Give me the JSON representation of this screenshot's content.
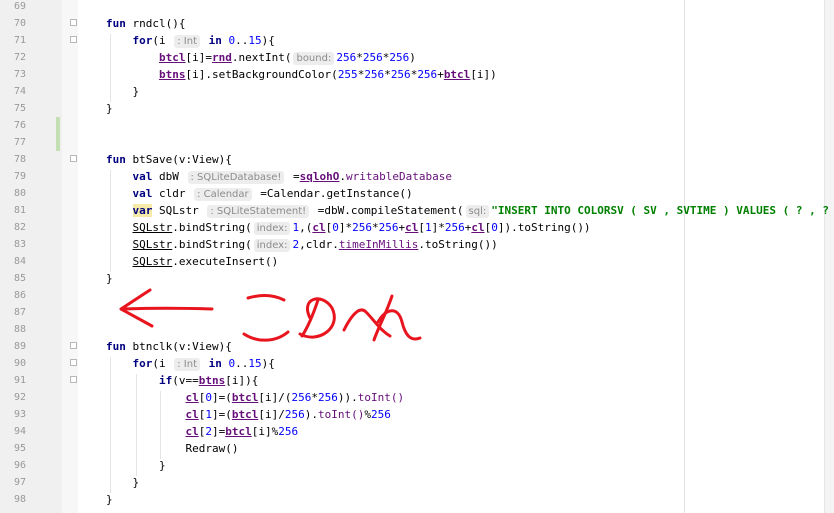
{
  "editor": {
    "line_numbers": [
      "69",
      "70",
      "71",
      "72",
      "73",
      "74",
      "75",
      "76",
      "77",
      "78",
      "79",
      "80",
      "81",
      "82",
      "83",
      "84",
      "85",
      "86",
      "87",
      "88",
      "89",
      "90",
      "91",
      "92",
      "93",
      "94",
      "95",
      "96",
      "97",
      "98"
    ],
    "lines": [
      [],
      [
        {
          "t": "fun ",
          "c": "kw"
        },
        {
          "t": "rndcl(){"
        }
      ],
      [
        {
          "t": "    "
        },
        {
          "t": "for",
          "c": "kw"
        },
        {
          "t": "(i "
        },
        {
          "t": ": Int",
          "c": "hint"
        },
        {
          "t": " in ",
          "c": "kw"
        },
        {
          "t": "0",
          "c": "num"
        },
        {
          "t": ".."
        },
        {
          "t": "15",
          "c": "num"
        },
        {
          "t": "){"
        }
      ],
      [
        {
          "t": "        "
        },
        {
          "t": "btcl",
          "c": "fld"
        },
        {
          "t": "[i]="
        },
        {
          "t": "rnd",
          "c": "fld"
        },
        {
          "t": ".nextInt("
        },
        {
          "t": "bound:",
          "c": "hint"
        },
        {
          "t": "256",
          "c": "num"
        },
        {
          "t": "*"
        },
        {
          "t": "256",
          "c": "num"
        },
        {
          "t": "*"
        },
        {
          "t": "256",
          "c": "num"
        },
        {
          "t": ")"
        }
      ],
      [
        {
          "t": "        "
        },
        {
          "t": "btns",
          "c": "fld"
        },
        {
          "t": "[i].setBackgroundColor("
        },
        {
          "t": "255",
          "c": "num"
        },
        {
          "t": "*"
        },
        {
          "t": "256",
          "c": "num"
        },
        {
          "t": "*"
        },
        {
          "t": "256",
          "c": "num"
        },
        {
          "t": "*"
        },
        {
          "t": "256",
          "c": "num"
        },
        {
          "t": "+"
        },
        {
          "t": "btcl",
          "c": "fld"
        },
        {
          "t": "[i])"
        }
      ],
      [
        {
          "t": "    }"
        }
      ],
      [
        {
          "t": "}"
        }
      ],
      [],
      [],
      [
        {
          "t": "fun ",
          "c": "kw"
        },
        {
          "t": "btSave(v:View){"
        }
      ],
      [
        {
          "t": "    "
        },
        {
          "t": "val ",
          "c": "kw"
        },
        {
          "t": "dbW "
        },
        {
          "t": ": SQLiteDatabase!",
          "c": "hint"
        },
        {
          "t": " ="
        },
        {
          "t": "sqlohO",
          "c": "fld"
        },
        {
          "t": "."
        },
        {
          "t": "writableDatabase",
          "c": "prop"
        }
      ],
      [
        {
          "t": "    "
        },
        {
          "t": "val ",
          "c": "kw"
        },
        {
          "t": "cldr "
        },
        {
          "t": ": Calendar",
          "c": "hint"
        },
        {
          "t": " =Calendar.getInstance()"
        }
      ],
      [
        {
          "t": "    "
        },
        {
          "t": "var",
          "c": "kw varhl"
        },
        {
          "t": " SQLstr "
        },
        {
          "t": ": SQLiteStatement!",
          "c": "hint"
        },
        {
          "t": " =dbW.compileStatement("
        },
        {
          "t": "sql:",
          "c": "hint"
        },
        {
          "t": "\"INSERT INTO COLORSV ( SV , SVTIME ) VALUES ( ? , ? )\"",
          "c": "str"
        },
        {
          "t": ")"
        }
      ],
      [
        {
          "t": "    "
        },
        {
          "t": "SQLstr",
          "c": "ul"
        },
        {
          "t": ".bindString("
        },
        {
          "t": "index:",
          "c": "hint"
        },
        {
          "t": "1",
          "c": "num"
        },
        {
          "t": ",("
        },
        {
          "t": "cl",
          "c": "fld"
        },
        {
          "t": "["
        },
        {
          "t": "0",
          "c": "num"
        },
        {
          "t": "]*"
        },
        {
          "t": "256",
          "c": "num"
        },
        {
          "t": "*"
        },
        {
          "t": "256",
          "c": "num"
        },
        {
          "t": "+"
        },
        {
          "t": "cl",
          "c": "fld"
        },
        {
          "t": "["
        },
        {
          "t": "1",
          "c": "num"
        },
        {
          "t": "]*"
        },
        {
          "t": "256",
          "c": "num"
        },
        {
          "t": "+"
        },
        {
          "t": "cl",
          "c": "fld"
        },
        {
          "t": "["
        },
        {
          "t": "0",
          "c": "num"
        },
        {
          "t": "]).toString())"
        }
      ],
      [
        {
          "t": "    "
        },
        {
          "t": "SQLstr",
          "c": "ul"
        },
        {
          "t": ".bindString("
        },
        {
          "t": "index:",
          "c": "hint"
        },
        {
          "t": "2",
          "c": "num"
        },
        {
          "t": ",cldr."
        },
        {
          "t": "timeInMillis",
          "c": "prop ul"
        },
        {
          "t": ".toString())"
        }
      ],
      [
        {
          "t": "    "
        },
        {
          "t": "SQLstr",
          "c": "ul"
        },
        {
          "t": ".executeInsert()"
        }
      ],
      [
        {
          "t": "}"
        }
      ],
      [],
      [],
      [],
      [
        {
          "t": "fun ",
          "c": "kw"
        },
        {
          "t": "btnclk(v:View){"
        }
      ],
      [
        {
          "t": "    "
        },
        {
          "t": "for",
          "c": "kw"
        },
        {
          "t": "(i "
        },
        {
          "t": ": Int",
          "c": "hint"
        },
        {
          "t": " in ",
          "c": "kw"
        },
        {
          "t": "0",
          "c": "num"
        },
        {
          "t": ".."
        },
        {
          "t": "15",
          "c": "num"
        },
        {
          "t": "){"
        }
      ],
      [
        {
          "t": "        "
        },
        {
          "t": "if",
          "c": "kw"
        },
        {
          "t": "(v=="
        },
        {
          "t": "btns",
          "c": "fld"
        },
        {
          "t": "[i]){"
        }
      ],
      [
        {
          "t": "            "
        },
        {
          "t": "cl",
          "c": "fld"
        },
        {
          "t": "["
        },
        {
          "t": "0",
          "c": "num"
        },
        {
          "t": "]=("
        },
        {
          "t": "btcl",
          "c": "fld"
        },
        {
          "t": "[i]/("
        },
        {
          "t": "256",
          "c": "num"
        },
        {
          "t": "*"
        },
        {
          "t": "256",
          "c": "num"
        },
        {
          "t": "))."
        },
        {
          "t": "toInt()",
          "c": "prop"
        }
      ],
      [
        {
          "t": "            "
        },
        {
          "t": "cl",
          "c": "fld"
        },
        {
          "t": "["
        },
        {
          "t": "1",
          "c": "num"
        },
        {
          "t": "]=("
        },
        {
          "t": "btcl",
          "c": "fld"
        },
        {
          "t": "[i]/"
        },
        {
          "t": "256",
          "c": "num"
        },
        {
          "t": ")."
        },
        {
          "t": "toInt()",
          "c": "prop"
        },
        {
          "t": "%"
        },
        {
          "t": "256",
          "c": "num"
        }
      ],
      [
        {
          "t": "            "
        },
        {
          "t": "cl",
          "c": "fld"
        },
        {
          "t": "["
        },
        {
          "t": "2",
          "c": "num"
        },
        {
          "t": "]="
        },
        {
          "t": "btcl",
          "c": "fld"
        },
        {
          "t": "[i]%"
        },
        {
          "t": "256",
          "c": "num"
        }
      ],
      [
        {
          "t": "            "
        },
        {
          "t": "Redraw()"
        }
      ],
      [
        {
          "t": "        }"
        }
      ],
      [
        {
          "t": "    }"
        }
      ],
      [
        {
          "t": "}"
        }
      ]
    ]
  },
  "annotation": {
    "handwritten_text": "このへん",
    "color": "#e8141e"
  }
}
